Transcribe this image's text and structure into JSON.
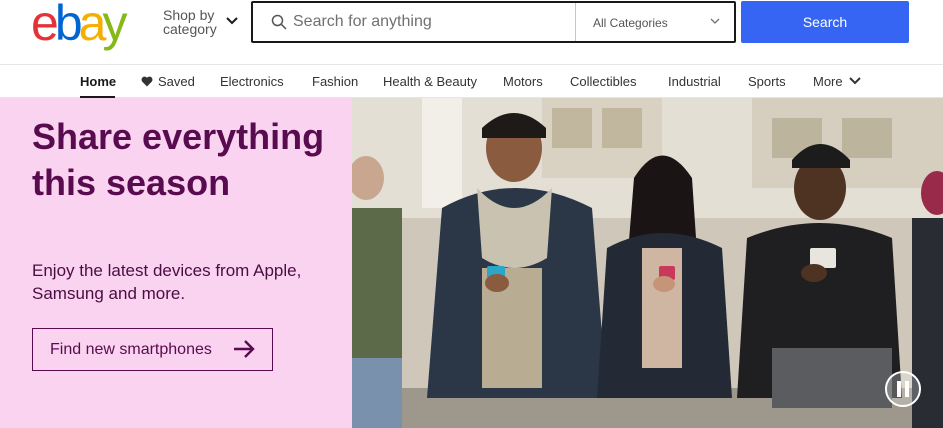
{
  "header": {
    "logo_letters": [
      {
        "ch": "e",
        "color": "#e53238"
      },
      {
        "ch": "b",
        "color": "#0064d2"
      },
      {
        "ch": "a",
        "color": "#f5af02"
      },
      {
        "ch": "y",
        "color": "#86b817"
      }
    ],
    "shop_by_line1": "Shop by",
    "shop_by_line2": "category",
    "search_placeholder": "Search for anything",
    "search_value": "",
    "category_selected": "All Categories",
    "search_button": "Search",
    "accent_color": "#3665f3"
  },
  "nav": {
    "items": [
      {
        "label": "Home",
        "active": true
      },
      {
        "label": "Saved",
        "icon": "heart-icon"
      },
      {
        "label": "Electronics"
      },
      {
        "label": "Fashion"
      },
      {
        "label": "Health & Beauty"
      },
      {
        "label": "Motors"
      },
      {
        "label": "Collectibles"
      },
      {
        "label": "Industrial"
      },
      {
        "label": "Sports"
      },
      {
        "label": "More",
        "icon": "chevron-down-icon"
      }
    ]
  },
  "hero": {
    "title": "Share everything this season",
    "subtitle": "Enjoy the latest devices from Apple, Samsung and more.",
    "cta_label": "Find new smartphones",
    "cta_icon": "arrow-right-icon",
    "pause_icon": "pause-icon",
    "background_color": "#f9d3f0",
    "text_color": "#590b4f"
  }
}
